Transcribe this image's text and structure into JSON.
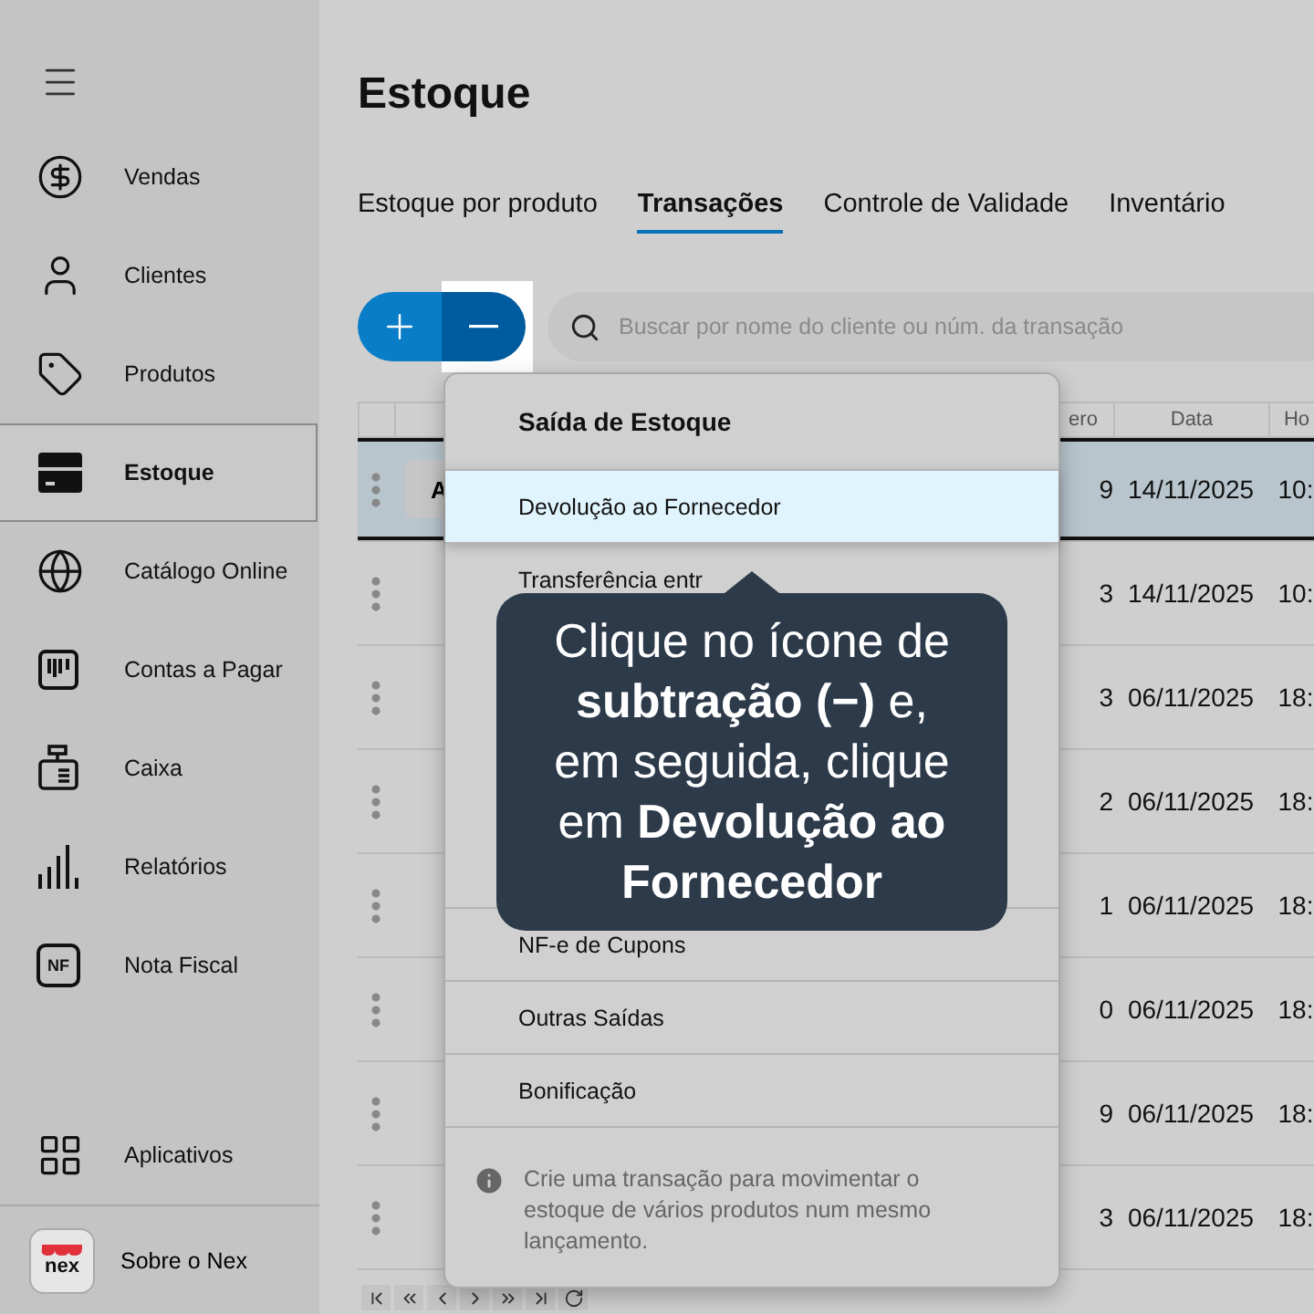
{
  "sidebar": {
    "items": [
      {
        "label": "Vendas",
        "selected": false
      },
      {
        "label": "Clientes",
        "selected": false
      },
      {
        "label": "Produtos",
        "selected": false
      },
      {
        "label": "Estoque",
        "selected": true
      },
      {
        "label": "Catálogo Online",
        "selected": false
      },
      {
        "label": "Contas a Pagar",
        "selected": false
      },
      {
        "label": "Caixa",
        "selected": false
      },
      {
        "label": "Relatórios",
        "selected": false
      },
      {
        "label": "Nota Fiscal",
        "icon_text": "NF",
        "selected": false
      }
    ],
    "apps": {
      "label": "Aplicativos"
    },
    "about": {
      "label": "Sobre o Nex",
      "logo_text": "nex"
    }
  },
  "page": {
    "title": "Estoque"
  },
  "tabs": [
    {
      "label": "Estoque por produto",
      "selected": false
    },
    {
      "label": "Transações",
      "selected": true
    },
    {
      "label": "Controle de Validade",
      "selected": false
    },
    {
      "label": "Inventário",
      "selected": false
    }
  ],
  "search": {
    "placeholder": "Buscar por nome do cliente ou núm. da transação"
  },
  "table": {
    "columns": [
      "ero",
      "Data",
      "Ho"
    ],
    "rows": [
      {
        "tag": "A",
        "number": "9",
        "date": "14/11/2025",
        "time": "10:",
        "selected": true
      },
      {
        "number": "3",
        "date": "14/11/2025",
        "time": "10:",
        "selected": false
      },
      {
        "number": "3",
        "date": "06/11/2025",
        "time": "18:",
        "selected": false
      },
      {
        "number": "2",
        "date": "06/11/2025",
        "time": "18:",
        "selected": false
      },
      {
        "number": "1",
        "date": "06/11/2025",
        "time": "18:",
        "selected": false
      },
      {
        "number": "0",
        "date": "06/11/2025",
        "time": "18:",
        "selected": false
      },
      {
        "number": "9",
        "date": "06/11/2025",
        "time": "18:",
        "selected": false
      },
      {
        "number": "3",
        "date": "06/11/2025",
        "time": "18:",
        "selected": false
      }
    ]
  },
  "menu": {
    "title": "Saída de Estoque",
    "items_top": [
      {
        "label": "Devolução ao Fornecedor",
        "selected": true
      },
      {
        "label": "Transferência entr",
        "selected": false
      }
    ],
    "items_bottom": [
      {
        "label": "NF-e de Cupons",
        "selected": false
      },
      {
        "label": "Outras Saídas",
        "selected": false
      },
      {
        "label": "Bonificação",
        "selected": false
      }
    ],
    "info": "Crie uma transação para movimentar o estoque de vários produtos num mesmo lançamento."
  },
  "tooltip": {
    "text": "Clique no ícone de **subtração (−)** e, em seguida, clique em **Devolução ao Fornecedor**"
  }
}
